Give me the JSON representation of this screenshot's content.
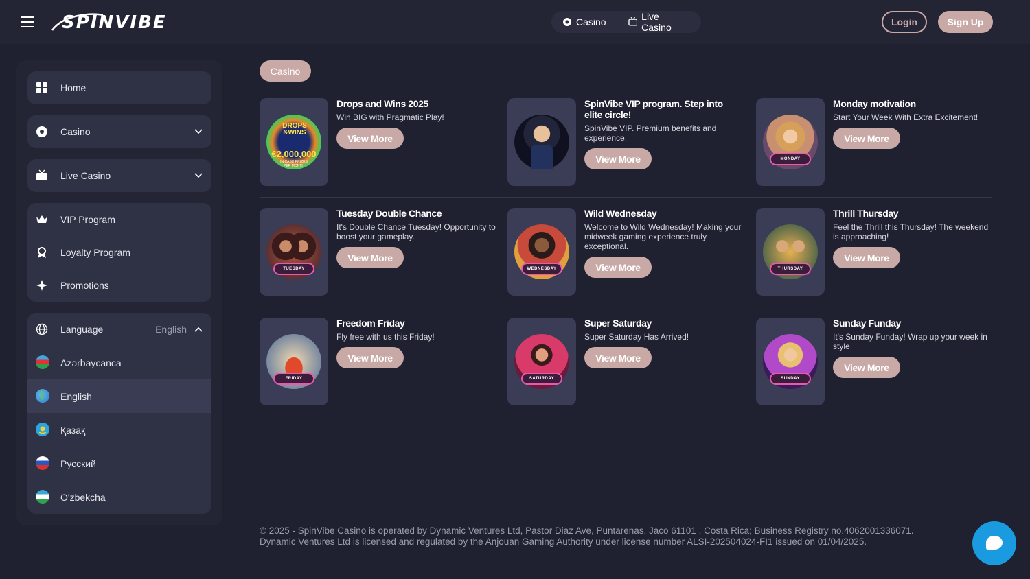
{
  "header": {
    "logo_text": "SPINVIBE",
    "nav": [
      {
        "label": "Casino",
        "icon": "casino-chip-icon"
      },
      {
        "label": "Live Casino",
        "icon": "live-tv-icon"
      }
    ],
    "login_label": "Login",
    "signup_label": "Sign Up"
  },
  "sidebar": {
    "home": "Home",
    "casino": "Casino",
    "live_casino": "Live Casino",
    "vip": "VIP Program",
    "loyalty": "Loyalty Program",
    "promotions": "Promotions",
    "language_label": "Language",
    "language_value": "English",
    "languages": [
      "Azərbaycanca",
      "English",
      "Қазақ",
      "Русский",
      "O'zbekcha"
    ]
  },
  "main": {
    "filter_chip": "Casino",
    "view_more": "View More",
    "promos": [
      {
        "title": "Drops and Wins 2025",
        "desc": "Win BIG with Pragmatic Play!",
        "thumb_lines": [
          "DROPS",
          "&WINS",
          "€2,000,000",
          "IN CASH PRIZES",
          "PER MONTH"
        ]
      },
      {
        "title": "SpinVibe VIP program. Step into elite circle!",
        "desc": "SpinVibe VIP. Premium benefits and experience."
      },
      {
        "title": "Monday motivation",
        "desc": "Start Your Week With Extra Excitement!",
        "badge": "MONDAY"
      },
      {
        "title": "Tuesday Double Chance",
        "desc": "It's Double Chance Tuesday! Opportunity to boost your gameplay.",
        "badge": "TUESDAY"
      },
      {
        "title": "Wild Wednesday",
        "desc": "Welcome to Wild Wednesday! Making your midweek gaming experience truly exceptional.",
        "badge": "WEDNESDAY"
      },
      {
        "title": "Thrill Thursday",
        "desc": "Feel the Thrill this Thursday! The weekend is approaching!",
        "badge": "THURSDAY"
      },
      {
        "title": "Freedom Friday",
        "desc": "Fly free with us this Friday!",
        "badge": "FRIDAY"
      },
      {
        "title": "Super Saturday",
        "desc": "Super Saturday Has Arrived!",
        "badge": "SATURDAY"
      },
      {
        "title": "Sunday Funday",
        "desc": "It's Sunday Funday! Wrap up your week in style",
        "badge": "SUNDAY"
      }
    ]
  },
  "footer": {
    "line1": "© 2025 - SpinVibe Casino is operated by Dynamic Ventures Ltd, Pastor Diaz Ave, Puntarenas, Jaco 61101 , Costa Rica; Business Registry no.4062001336071.",
    "line2": "Dynamic Ventures Ltd is licensed and regulated by the Anjouan Gaming Authority under license number ALSI-202504024-FI1 issued on 01/04/2025."
  },
  "colors": {
    "accent": "#c9a9a6",
    "chat": "#1a9be0",
    "bg": "#1f2130",
    "panel": "#2f3144"
  }
}
